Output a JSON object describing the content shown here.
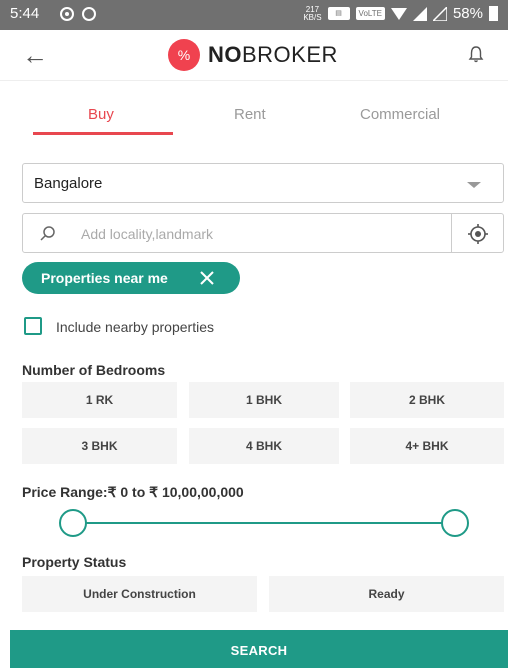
{
  "status_bar": {
    "time": "5:44",
    "speed": "217",
    "speed_unit": "KB/S",
    "volte": "VoLTE",
    "battery": "58%"
  },
  "header": {
    "logo_bold": "NO",
    "logo_rest": "BROKER",
    "logo_mark": "%"
  },
  "tabs": [
    {
      "label": "Buy",
      "active": true
    },
    {
      "label": "Rent",
      "active": false
    },
    {
      "label": "Commercial",
      "active": false
    }
  ],
  "city_select": {
    "value": "Bangalore"
  },
  "search": {
    "placeholder": "Add locality,landmark",
    "value": ""
  },
  "chip": {
    "label": "Properties near me"
  },
  "nearby": {
    "label": "Include nearby properties",
    "checked": false
  },
  "bedrooms": {
    "title": "Number of Bedrooms",
    "options": [
      "1 RK",
      "1 BHK",
      "2 BHK",
      "3 BHK",
      "4 BHK",
      "4+ BHK"
    ]
  },
  "price": {
    "label": "Price Range:₹ 0  to  ₹ 10,00,00,000",
    "min_fraction": 0,
    "max_fraction": 1
  },
  "property_status": {
    "title": "Property Status",
    "options": [
      "Under Construction",
      "Ready"
    ]
  },
  "search_button": {
    "label": "SEARCH"
  },
  "colors": {
    "accent": "#1f9a87",
    "brand_red": "#e8474f",
    "status_bar": "#707070"
  },
  "icons": [
    "back-arrow-icon",
    "logo-icon",
    "bell-icon",
    "chevron-down-icon",
    "search-icon",
    "locate-icon",
    "close-icon",
    "wifi-icon",
    "signal-icon",
    "battery-icon"
  ]
}
